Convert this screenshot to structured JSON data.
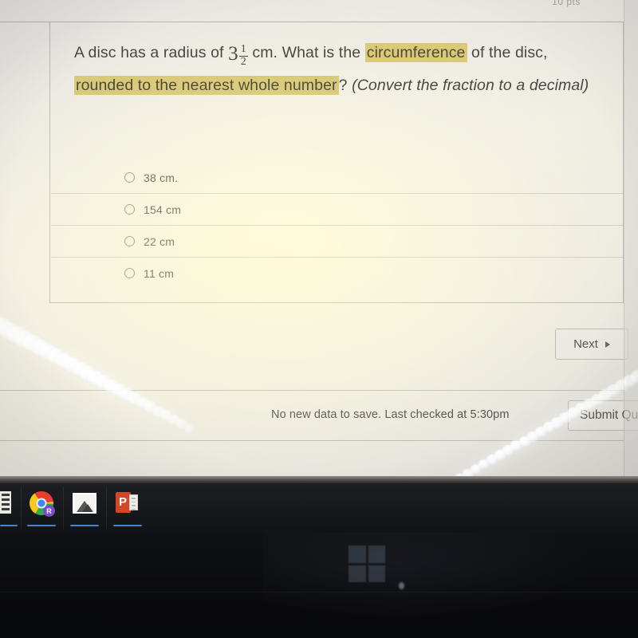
{
  "scene": {
    "description": "photo-of-monitor-quiz-question"
  },
  "quiz": {
    "points_label": "10 pts",
    "question": {
      "part1": "A disc has a radius of",
      "mixed_number": {
        "whole": "3",
        "numerator": "1",
        "denominator": "2"
      },
      "part2": "cm. What is the",
      "highlight1": "circumference",
      "part3": "of the disc,",
      "highlight2": "rounded to the nearest whole number",
      "part4": "?",
      "parenthetical": "(Convert the fraction to a decimal)"
    },
    "options": [
      {
        "label": "38 cm.",
        "selected": false
      },
      {
        "label": "154 cm",
        "selected": false
      },
      {
        "label": "22 cm",
        "selected": false
      },
      {
        "label": "11 cm",
        "selected": false
      }
    ],
    "next_button": "Next",
    "save_status": "No new data to save. Last checked at 5:30pm",
    "submit_button": "Submit Qui"
  },
  "taskbar": {
    "items": [
      {
        "name": "partial-app-icon",
        "icon": "list-icon"
      },
      {
        "name": "chrome",
        "icon": "chrome-icon",
        "badge": "R"
      },
      {
        "name": "photos",
        "icon": "photo-icon"
      },
      {
        "name": "powerpoint",
        "icon": "powerpoint-icon"
      }
    ]
  },
  "colors": {
    "highlight": "#d6c56a",
    "text": "#4a4845",
    "screen_bg": "#ece9e0",
    "taskbar_bg": "#17181c",
    "accent_underline": "#4d90d8"
  }
}
